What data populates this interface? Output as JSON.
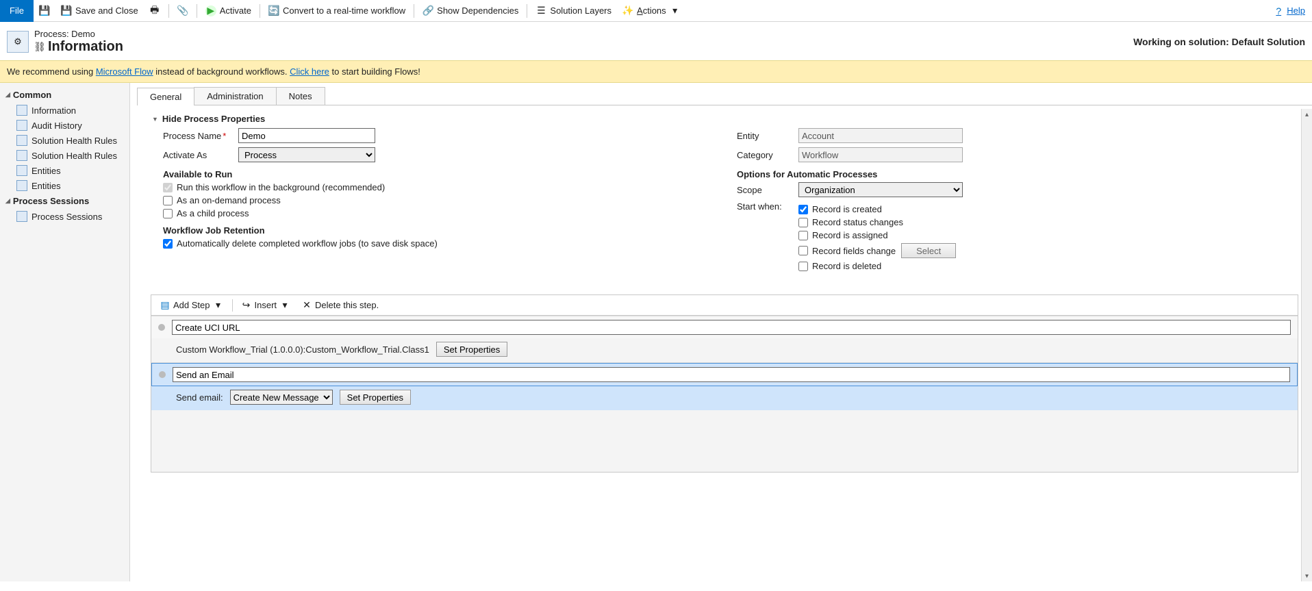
{
  "toolbar": {
    "file": "File",
    "save_close": "Save and Close",
    "activate": "Activate",
    "convert": "Convert to a real-time workflow",
    "show_deps": "Show Dependencies",
    "solution_layers": "Solution Layers",
    "actions": "Actions",
    "help": "Help"
  },
  "header": {
    "crumb": "Process: Demo",
    "title": "Information",
    "solution": "Working on solution: Default Solution"
  },
  "banner": {
    "prefix": "We recommend using ",
    "link1": "Microsoft Flow",
    "mid": " instead of background workflows. ",
    "link2": "Click here",
    "suffix": " to start building Flows!"
  },
  "sidebar": {
    "common": "Common",
    "items": {
      "information": "Information",
      "audit": "Audit History",
      "shr1": "Solution Health Rules",
      "shr2": "Solution Health Rules",
      "ent1": "Entities",
      "ent2": "Entities"
    },
    "sessions_hdr": "Process Sessions",
    "sessions_item": "Process Sessions"
  },
  "tabs": {
    "general": "General",
    "admin": "Administration",
    "notes": "Notes"
  },
  "section": {
    "hide_props": "Hide Process Properties"
  },
  "left": {
    "process_name_lbl": "Process Name",
    "process_name_val": "Demo",
    "activate_as_lbl": "Activate As",
    "activate_as_val": "Process",
    "available_hdr": "Available to Run",
    "run_bg": "Run this workflow in the background (recommended)",
    "on_demand": "As an on-demand process",
    "as_child": "As a child process",
    "retention_hdr": "Workflow Job Retention",
    "auto_delete": "Automatically delete completed workflow jobs (to save disk space)"
  },
  "right": {
    "entity_lbl": "Entity",
    "entity_val": "Account",
    "category_lbl": "Category",
    "category_val": "Workflow",
    "options_hdr": "Options for Automatic Processes",
    "scope_lbl": "Scope",
    "scope_val": "Organization",
    "start_when_lbl": "Start when:",
    "created": "Record is created",
    "status": "Record status changes",
    "assigned": "Record is assigned",
    "fields": "Record fields change",
    "select_btn": "Select",
    "deleted": "Record is deleted"
  },
  "designer": {
    "add_step": "Add Step",
    "insert": "Insert",
    "delete": "Delete this step.",
    "step1_desc": "Create UCI URL",
    "step1_detail": "Custom Workflow_Trial (1.0.0.0):Custom_Workflow_Trial.Class1",
    "set_props": "Set Properties",
    "step2_desc": "Send an Email",
    "send_email_lbl": "Send email:",
    "send_email_opt": "Create New Message"
  }
}
